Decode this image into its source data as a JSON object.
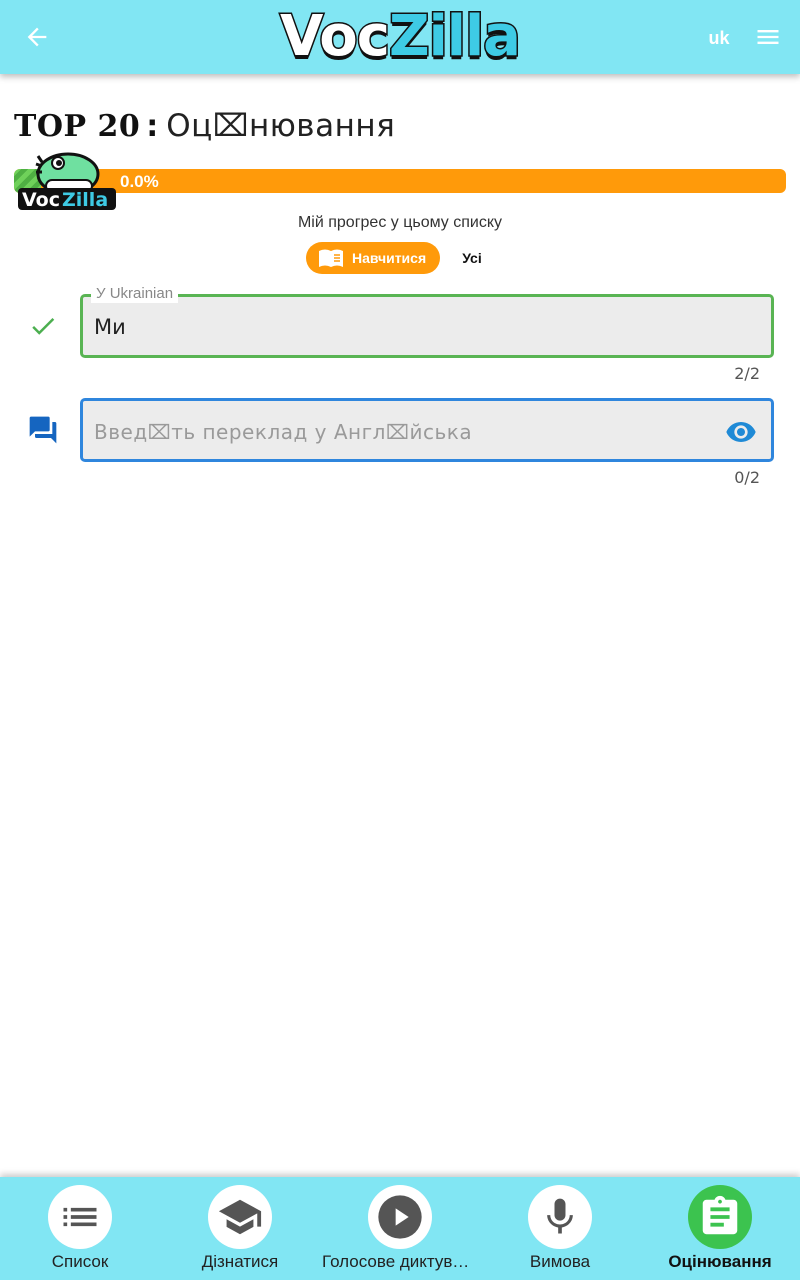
{
  "header": {
    "back_icon": "arrow-left-icon",
    "logo_part1": "Voc",
    "logo_part2": "Zilla",
    "lang": "uk",
    "menu_icon": "hamburger-menu-icon",
    "color": "#81e6f3"
  },
  "title": {
    "strong": "TOP 20",
    "separator": ":",
    "rest": "Оц⌧нювання"
  },
  "progress": {
    "value_text": "0.0%",
    "percent": 0.0,
    "caption": "Мій прогрес у цьому списку",
    "mascot_icon": "voczilla-mascot-icon",
    "bar_color": "#ff9a0a"
  },
  "toggle": {
    "learn_label": "Навчитися",
    "learn_icon": "book-icon",
    "all_label": "Усі",
    "selected": "learn"
  },
  "fields": [
    {
      "label": "У Ukrainian",
      "value": "Ми",
      "counter": "2/2",
      "status_icon": "check-icon",
      "border_color": "#59b453"
    },
    {
      "placeholder": "Введ⌧ть переклад у Англ⌧йська",
      "value": "",
      "counter": "0/2",
      "status_icon": "chat-bubbles-icon",
      "action_icon": "eye-icon",
      "border_color": "#2f86dd"
    }
  ],
  "bottom_nav": {
    "items": [
      {
        "label": "Список",
        "icon": "list-icon"
      },
      {
        "label": "Дізнатися",
        "icon": "graduation-cap-icon"
      },
      {
        "label": "Голосове диктування",
        "icon": "play-icon"
      },
      {
        "label": "Вимова",
        "icon": "microphone-icon"
      },
      {
        "label": "Оцінювання",
        "icon": "clipboard-icon"
      }
    ],
    "active": "Оцінювання",
    "active_color": "#3cc34f"
  }
}
